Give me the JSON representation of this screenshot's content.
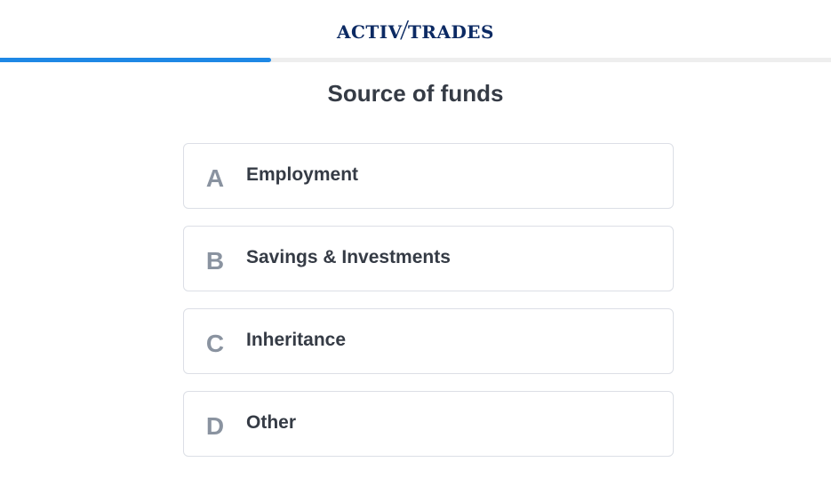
{
  "brand": {
    "logo_part1": "ACTIV",
    "logo_slash": "/",
    "logo_part2": "TRADES"
  },
  "progress": {
    "fraction": 0.326,
    "color": "#1e88e5"
  },
  "question": {
    "title": "Source of funds"
  },
  "options": [
    {
      "key": "A",
      "label": "Employment"
    },
    {
      "key": "B",
      "label": "Savings & Investments"
    },
    {
      "key": "C",
      "label": "Inheritance"
    },
    {
      "key": "D",
      "label": "Other"
    }
  ]
}
